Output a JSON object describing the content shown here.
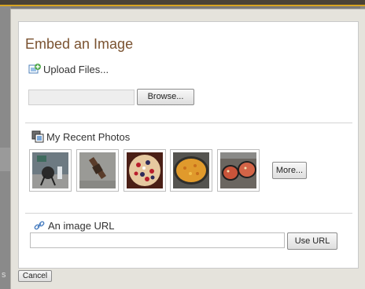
{
  "dialog": {
    "title": "Embed an Image",
    "upload": {
      "label": "Upload Files...",
      "field_value": "",
      "browse_label": "Browse..."
    },
    "recent": {
      "label": "My Recent Photos",
      "more_label": "More...",
      "photos": [
        {
          "name": "thumb-1-icon"
        },
        {
          "name": "thumb-2-icon"
        },
        {
          "name": "thumb-3-icon"
        },
        {
          "name": "thumb-4-icon"
        },
        {
          "name": "thumb-5-icon"
        }
      ]
    },
    "url": {
      "label": "An image URL",
      "value": "",
      "button_label": "Use URL"
    },
    "cancel_label": "Cancel"
  },
  "colors": {
    "title": "#7a5230",
    "accent": "#d8a522",
    "link_icon": "#4a7fc1"
  }
}
